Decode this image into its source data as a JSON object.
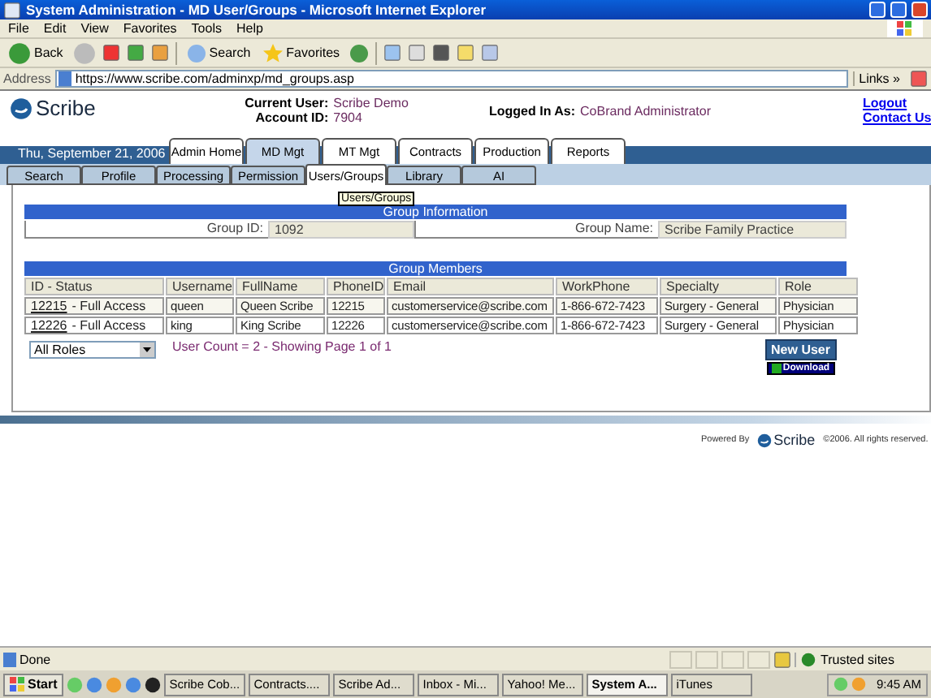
{
  "window": {
    "title": "System Administration - MD User/Groups - Microsoft Internet Explorer"
  },
  "menu": [
    "File",
    "Edit",
    "View",
    "Favorites",
    "Tools",
    "Help"
  ],
  "toolbar": {
    "back": "Back",
    "search": "Search",
    "favorites": "Favorites"
  },
  "address": {
    "label": "Address",
    "url": "https://www.scribe.com/adminxp/md_groups.asp",
    "links": "Links",
    "chevron": "»"
  },
  "header": {
    "logo": "Scribe",
    "current_user_label": "Current User:",
    "current_user": "Scribe Demo",
    "account_label": "Account ID:",
    "account_id": "7904",
    "logged_in_label": "Logged In As:",
    "logged_in": "CoBrand Administrator",
    "links": [
      "Logout",
      "Contact Us"
    ]
  },
  "date": "Thu, September 21, 2006",
  "main_tabs": [
    {
      "label": "Admin Home",
      "selected": false
    },
    {
      "label": "MD Mgt",
      "selected": true
    },
    {
      "label": "MT Mgt",
      "selected": false
    },
    {
      "label": "Contracts",
      "selected": false
    },
    {
      "label": "Production",
      "selected": false
    },
    {
      "label": "Reports",
      "selected": false
    }
  ],
  "sub_tabs": [
    {
      "label": "Search",
      "selected": false
    },
    {
      "label": "Profile",
      "selected": false
    },
    {
      "label": "Processing",
      "selected": false
    },
    {
      "label": "Permission",
      "selected": false
    },
    {
      "label": "Users/Groups",
      "selected": true
    },
    {
      "label": "Library",
      "selected": false
    },
    {
      "label": "AI",
      "selected": false
    }
  ],
  "tooltip": "Users/Groups",
  "group_info": {
    "title": "Group Information",
    "fields": [
      {
        "label": "Group ID:",
        "value": "1092"
      },
      {
        "label": "Group Name:",
        "value": "Scribe Family Practice"
      }
    ]
  },
  "members": {
    "title": "Group Members",
    "columns": [
      "ID - Status",
      "Username",
      "FullName",
      "PhoneID",
      "Email",
      "WorkPhone",
      "Specialty",
      "Role"
    ],
    "rows": [
      {
        "id": "12215",
        "status": "- Full Access",
        "username": "queen",
        "fullname": "Queen Scribe",
        "phone_id": "12215",
        "email": "customerservice@scribe.com",
        "work_phone": "1-866-672-7423",
        "specialty": "Surgery - General",
        "role": "Physician"
      },
      {
        "id": "12226",
        "status": "- Full Access",
        "username": "king",
        "fullname": "King Scribe",
        "phone_id": "12226",
        "email": "customerservice@scribe.com",
        "work_phone": "1-866-672-7423",
        "specialty": "Surgery - General",
        "role": "Physician"
      }
    ]
  },
  "role_filter": "All Roles",
  "user_count": "User Count = 2 - Showing Page 1 of 1",
  "new_user": "New User",
  "download": "Download",
  "footer": {
    "powered": "Powered By",
    "logo": "Scribe",
    "copyright": "©2006. All rights reserved."
  },
  "status_bar": {
    "text": "Done",
    "zone": "Trusted sites"
  },
  "taskbar": {
    "start": "Start",
    "items": [
      {
        "label": "Scribe Cob...",
        "selected": false
      },
      {
        "label": "Contracts....",
        "selected": false
      },
      {
        "label": "Scribe Ad...",
        "selected": false
      },
      {
        "label": "Inbox - Mi...",
        "selected": false
      },
      {
        "label": "Yahoo! Me...",
        "selected": false
      },
      {
        "label": "System A...",
        "selected": true
      },
      {
        "label": "iTunes",
        "selected": false
      }
    ],
    "time": "9:45 AM"
  }
}
